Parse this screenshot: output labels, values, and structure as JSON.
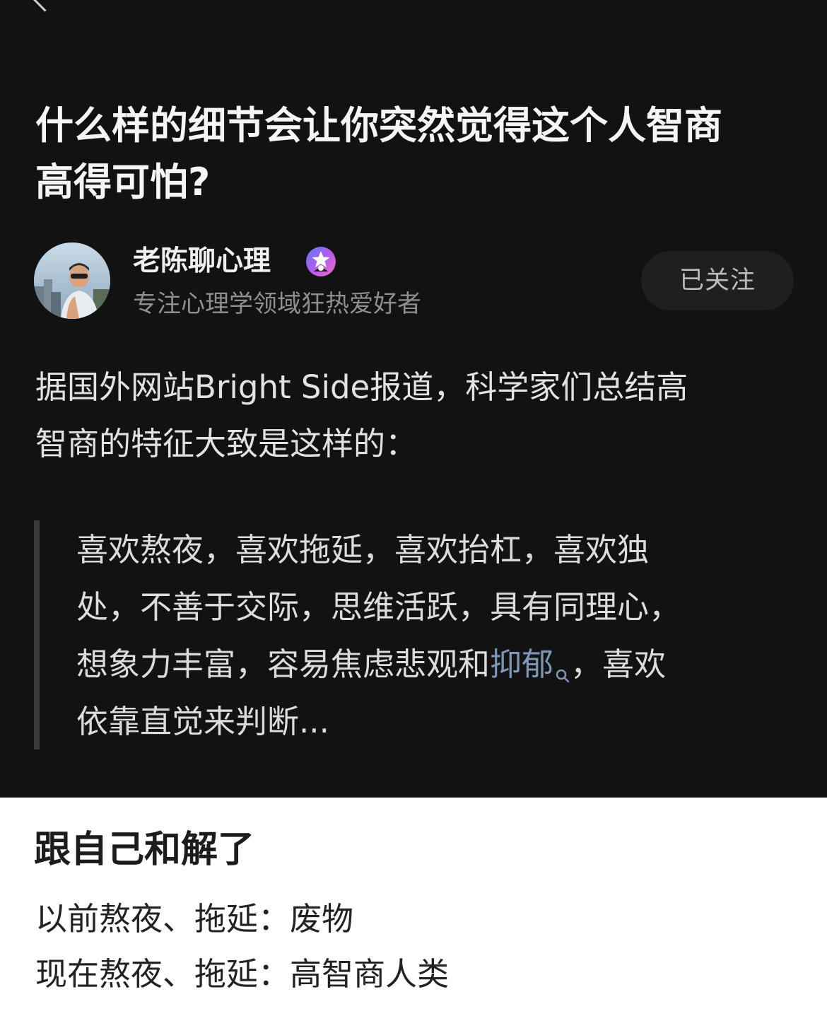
{
  "question": {
    "title_lines": [
      "什么样的细节会让你突然觉得这个人智商",
      "高得可怕?"
    ]
  },
  "author": {
    "name": "老陈聊心理",
    "badge_icon": "verified-star-badge-icon",
    "description": "专注心理学领域狂热爱好者",
    "follow_label": "已关注"
  },
  "answer": {
    "intro_lines": [
      "据国外网站Bright Side报道，科学家们总结高",
      "智商的特征大致是这样的："
    ],
    "quote": {
      "line1": "喜欢熬夜，喜欢拖延，喜欢抬杠，喜欢独",
      "line2": "处，不善于交际，思维活跃，具有同理心，",
      "line3_before": "想象力丰富，容易焦虑悲观和",
      "line3_link": "抑郁",
      "line3_after": "，喜欢",
      "line4": "依靠直觉来判断..."
    }
  },
  "caption": {
    "title": "跟自己和解了",
    "line1": "以前熬夜、拖延：废物",
    "line2": "现在熬夜、拖延：高智商人类"
  },
  "colors": {
    "dark_background": "#121212",
    "link": "#7d97b8",
    "caption_background": "#ffffff"
  }
}
